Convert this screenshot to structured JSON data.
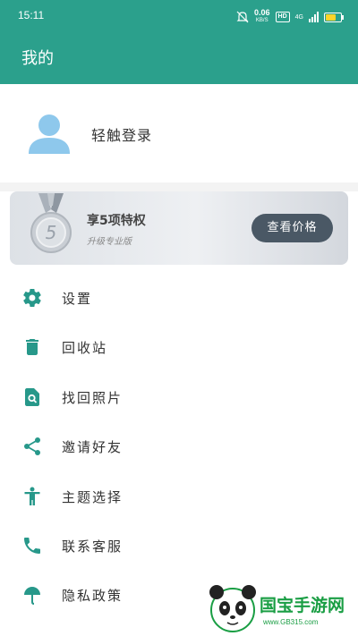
{
  "status_bar": {
    "time": "15:11",
    "net_speed": "0.06",
    "net_unit": "KB/S",
    "hd": "HD",
    "network": "4G",
    "battery_level": 0.7
  },
  "header": {
    "title": "我的"
  },
  "profile": {
    "login_label": "轻触登录"
  },
  "vip": {
    "title": "享5项特权",
    "subtitle": "升级专业版",
    "price_button": "查看价格",
    "medal_number": "5"
  },
  "menu": {
    "items": [
      {
        "label": "设置",
        "icon": "gear-icon"
      },
      {
        "label": "回收站",
        "icon": "trash-icon"
      },
      {
        "label": "找回照片",
        "icon": "photo-search-icon"
      },
      {
        "label": "邀请好友",
        "icon": "share-icon"
      },
      {
        "label": "主题选择",
        "icon": "person-icon"
      },
      {
        "label": "联系客服",
        "icon": "phone-icon"
      },
      {
        "label": "隐私政策",
        "icon": "umbrella-icon"
      }
    ]
  },
  "watermark": {
    "text": "国宝手游网",
    "url": "www.GB315.com"
  },
  "colors": {
    "primary": "#2ba08c",
    "avatar": "#8ec8ec",
    "icon": "#27988a"
  }
}
